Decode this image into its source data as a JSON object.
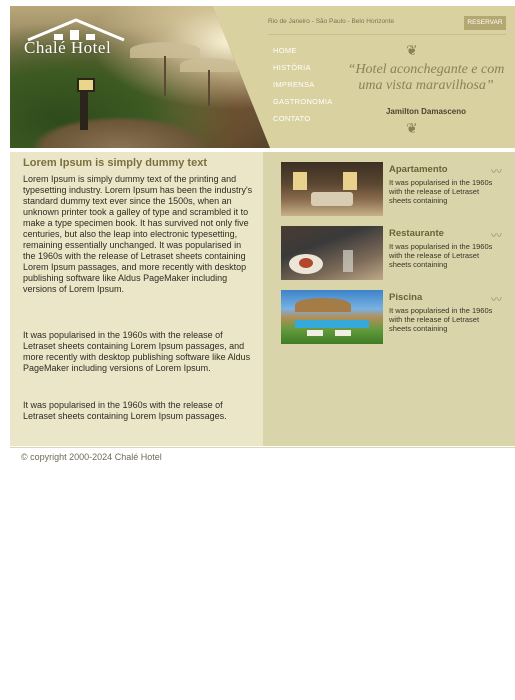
{
  "brand": {
    "name": "Chalé Hotel"
  },
  "header": {
    "cities": "Rio de Janeiro - São Paulo - Belo Horizonte",
    "reserve_label": "RESERVAR",
    "nav": [
      "HOME",
      "HISTÓRIA",
      "IMPRENSA",
      "GASTRONOMIA",
      "CONTATO"
    ],
    "tagline": "“Hotel aconchegante e com uma vista maravilhosa”",
    "author": "Jamilton Damasceno"
  },
  "article": {
    "title": "Lorem Ipsum is simply dummy text",
    "paragraphs": [
      "Lorem Ipsum is simply dummy text of the printing and typesetting industry. Lorem Ipsum has been the industry's standard dummy text ever since the 1500s, when an unknown printer took a galley of type and scrambled it to make a type specimen book. It has survived not only five centuries, but also the leap into electronic typesetting, remaining essentially unchanged. It was popularised in the 1960s with the release of Letraset sheets containing Lorem Ipsum passages, and more recently with desktop publishing software like Aldus PageMaker including versions of Lorem Ipsum.",
      "It was popularised in the 1960s with the release of Letraset sheets containing Lorem Ipsum passages, and more recently with desktop publishing software like Aldus PageMaker including versions of Lorem Ipsum.",
      "It was popularised in the 1960s with the release of Letraset sheets containing Lorem Ipsum passages."
    ]
  },
  "cards": [
    {
      "title": "Apartamento",
      "text": "It was popularised in the 1960s with the release of Letraset sheets containing"
    },
    {
      "title": "Restaurante",
      "text": "It was popularised in the 1960s with the release of Letraset sheets containing"
    },
    {
      "title": "Piscina",
      "text": "It was popularised in the 1960s with the release of Letraset sheets containing"
    }
  ],
  "footer": {
    "copyright": "© copyright 2000-2024 Chalé Hotel"
  },
  "colors": {
    "header": "#d9d1a0",
    "left_panel": "#ebe6c8",
    "right_panel": "#d9d4aa",
    "accent": "#b3a872"
  },
  "icons": [
    "ornament-top-icon",
    "ornament-bottom-icon",
    "swirl-icon"
  ]
}
